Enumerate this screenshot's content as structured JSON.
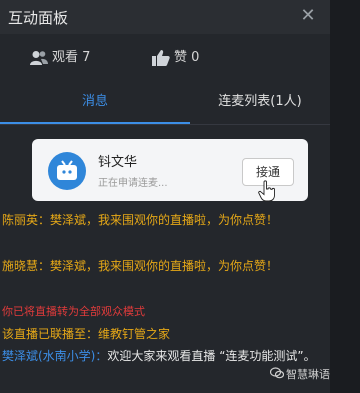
{
  "panel": {
    "title": "互动面板",
    "close_glyph": "✕"
  },
  "stats": {
    "viewers_label": "观看 7",
    "likes_label": "赞 0"
  },
  "tabs": [
    {
      "label": "消息",
      "active": true
    },
    {
      "label": "连麦列表(1人)",
      "active": false
    }
  ],
  "request_card": {
    "name": "钭文华",
    "subtitle": "正在申请连麦...",
    "accept_label": "接通"
  },
  "messages": [
    {
      "text": "陈丽英：樊泽斌，我来围观你的直播啦，为你点赞！"
    },
    {
      "text": "施晓慧：樊泽斌，我来围观你的直播啦，为你点赞！"
    },
    {
      "text": "你已将直播转为全部观众模式"
    },
    {
      "text": "该直播已联播至：维教钉管之家"
    },
    {
      "name": "樊泽斌(水南小学)：",
      "text": "欢迎大家来观看直播 “连麦功能测试”。"
    }
  ],
  "watermark": "智慧琳语",
  "colors": {
    "accent": "#3c8ee6",
    "system_msg": "#e6a817",
    "warning_msg": "#e23b3b"
  }
}
